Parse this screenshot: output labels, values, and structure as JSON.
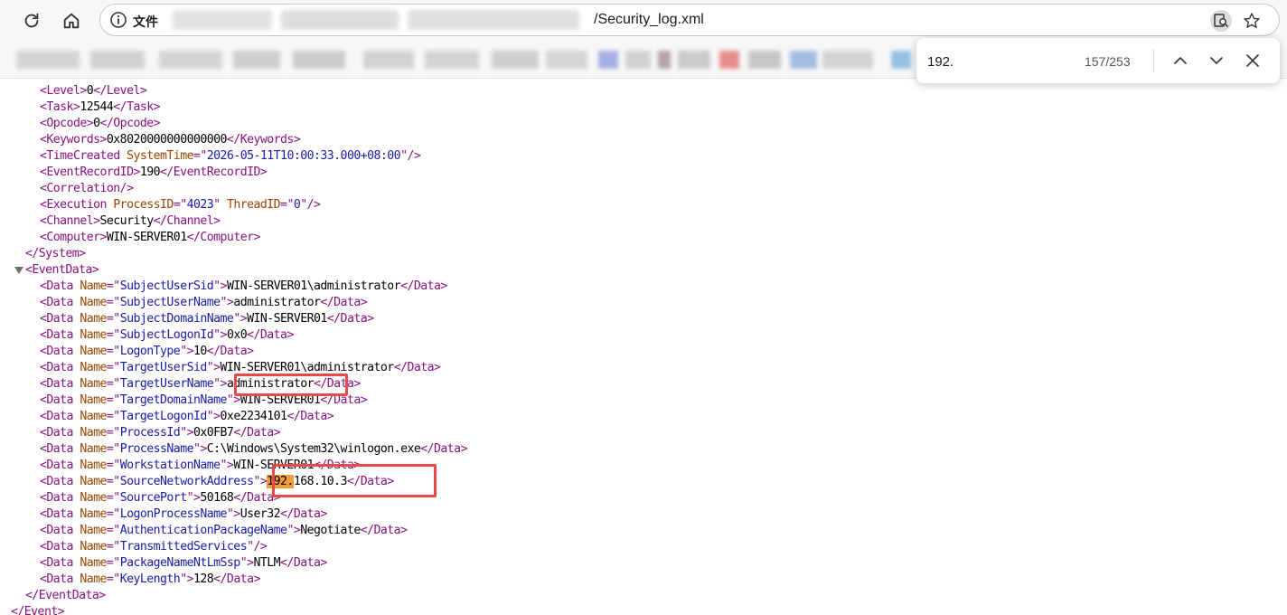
{
  "address_bar": {
    "scheme_label": "文件",
    "url_visible": "/Security_log.xml"
  },
  "find_bar": {
    "query": "192.",
    "match_count": "157/253"
  },
  "xml_lines": [
    [
      [
        "tag",
        "<Level>"
      ],
      [
        "text",
        "0"
      ],
      [
        "tag",
        "</Level>"
      ]
    ],
    [
      [
        "tag",
        "<Task>"
      ],
      [
        "text",
        "12544"
      ],
      [
        "tag",
        "</Task>"
      ]
    ],
    [
      [
        "tag",
        "<Opcode>"
      ],
      [
        "text",
        "0"
      ],
      [
        "tag",
        "</Opcode>"
      ]
    ],
    [
      [
        "tag",
        "<Keywords>"
      ],
      [
        "text",
        "0x8020000000000000"
      ],
      [
        "tag",
        "</Keywords>"
      ]
    ],
    [
      [
        "tag",
        "<TimeCreated "
      ],
      [
        "attr",
        "SystemTime"
      ],
      [
        "tag",
        "=\""
      ],
      [
        "val",
        "2026-05-11T10:00:33.000+08:00"
      ],
      [
        "tag",
        "\"/>"
      ]
    ],
    [
      [
        "tag",
        "<EventRecordID>"
      ],
      [
        "text",
        "190"
      ],
      [
        "tag",
        "</EventRecordID>"
      ]
    ],
    [
      [
        "tag",
        "<Correlation/>"
      ]
    ],
    [
      [
        "tag",
        "<Execution "
      ],
      [
        "attr",
        "ProcessID"
      ],
      [
        "tag",
        "=\""
      ],
      [
        "val",
        "4023"
      ],
      [
        "tag",
        "\" "
      ],
      [
        "attr",
        "ThreadID"
      ],
      [
        "tag",
        "=\""
      ],
      [
        "val",
        "0"
      ],
      [
        "tag",
        "\"/>"
      ]
    ],
    [
      [
        "tag",
        "<Channel>"
      ],
      [
        "text",
        "Security"
      ],
      [
        "tag",
        "</Channel>"
      ]
    ],
    [
      [
        "tag",
        "<Computer>"
      ],
      [
        "text",
        "WIN-SERVER01"
      ],
      [
        "tag",
        "</Computer>"
      ]
    ],
    [
      [
        "tag",
        "</System>"
      ]
    ],
    [
      [
        "tag",
        "<EventData>"
      ]
    ],
    [
      [
        "tag",
        "<Data "
      ],
      [
        "attr",
        "Name"
      ],
      [
        "tag",
        "=\""
      ],
      [
        "val",
        "SubjectUserSid"
      ],
      [
        "tag",
        "\">"
      ],
      [
        "text",
        "WIN-SERVER01\\administrator"
      ],
      [
        "tag",
        "</Data>"
      ]
    ],
    [
      [
        "tag",
        "<Data "
      ],
      [
        "attr",
        "Name"
      ],
      [
        "tag",
        "=\""
      ],
      [
        "val",
        "SubjectUserName"
      ],
      [
        "tag",
        "\">"
      ],
      [
        "text",
        "administrator"
      ],
      [
        "tag",
        "</Data>"
      ]
    ],
    [
      [
        "tag",
        "<Data "
      ],
      [
        "attr",
        "Name"
      ],
      [
        "tag",
        "=\""
      ],
      [
        "val",
        "SubjectDomainName"
      ],
      [
        "tag",
        "\">"
      ],
      [
        "text",
        "WIN-SERVER01"
      ],
      [
        "tag",
        "</Data>"
      ]
    ],
    [
      [
        "tag",
        "<Data "
      ],
      [
        "attr",
        "Name"
      ],
      [
        "tag",
        "=\""
      ],
      [
        "val",
        "SubjectLogonId"
      ],
      [
        "tag",
        "\">"
      ],
      [
        "text",
        "0x0"
      ],
      [
        "tag",
        "</Data>"
      ]
    ],
    [
      [
        "tag",
        "<Data "
      ],
      [
        "attr",
        "Name"
      ],
      [
        "tag",
        "=\""
      ],
      [
        "val",
        "LogonType"
      ],
      [
        "tag",
        "\">"
      ],
      [
        "text",
        "10"
      ],
      [
        "tag",
        "</Data>"
      ]
    ],
    [
      [
        "tag",
        "<Data "
      ],
      [
        "attr",
        "Name"
      ],
      [
        "tag",
        "=\""
      ],
      [
        "val",
        "TargetUserSid"
      ],
      [
        "tag",
        "\">"
      ],
      [
        "text",
        "WIN-SERVER01\\administrator"
      ],
      [
        "tag",
        "</Data>"
      ]
    ],
    [
      [
        "tag",
        "<Data "
      ],
      [
        "attr",
        "Name"
      ],
      [
        "tag",
        "=\""
      ],
      [
        "val",
        "TargetUserName"
      ],
      [
        "tag",
        "\">"
      ],
      [
        "text",
        "administrator"
      ],
      [
        "tag",
        "</Data>"
      ]
    ],
    [
      [
        "tag",
        "<Data "
      ],
      [
        "attr",
        "Name"
      ],
      [
        "tag",
        "=\""
      ],
      [
        "val",
        "TargetDomainName"
      ],
      [
        "tag",
        "\">"
      ],
      [
        "text",
        "WIN-SERVER01"
      ],
      [
        "tag",
        "</Data>"
      ]
    ],
    [
      [
        "tag",
        "<Data "
      ],
      [
        "attr",
        "Name"
      ],
      [
        "tag",
        "=\""
      ],
      [
        "val",
        "TargetLogonId"
      ],
      [
        "tag",
        "\">"
      ],
      [
        "text",
        "0xe2234101"
      ],
      [
        "tag",
        "</Data>"
      ]
    ],
    [
      [
        "tag",
        "<Data "
      ],
      [
        "attr",
        "Name"
      ],
      [
        "tag",
        "=\""
      ],
      [
        "val",
        "ProcessId"
      ],
      [
        "tag",
        "\">"
      ],
      [
        "text",
        "0x0FB7"
      ],
      [
        "tag",
        "</Data>"
      ]
    ],
    [
      [
        "tag",
        "<Data "
      ],
      [
        "attr",
        "Name"
      ],
      [
        "tag",
        "=\""
      ],
      [
        "val",
        "ProcessName"
      ],
      [
        "tag",
        "\">"
      ],
      [
        "text",
        "C:\\Windows\\System32\\winlogon.exe"
      ],
      [
        "tag",
        "</Data>"
      ]
    ],
    [
      [
        "tag",
        "<Data "
      ],
      [
        "attr",
        "Name"
      ],
      [
        "tag",
        "=\""
      ],
      [
        "val",
        "WorkstationName"
      ],
      [
        "tag",
        "\">"
      ],
      [
        "text",
        "WIN-SERVER01"
      ],
      [
        "tag",
        "</Data>"
      ]
    ],
    [
      [
        "tag",
        "<Data "
      ],
      [
        "attr",
        "Name"
      ],
      [
        "tag",
        "=\""
      ],
      [
        "val",
        "SourceNetworkAddress"
      ],
      [
        "tag",
        "\">"
      ],
      [
        "mark",
        "192."
      ],
      [
        "text",
        "168.10.3"
      ],
      [
        "tag",
        "</Data>"
      ]
    ],
    [
      [
        "tag",
        "<Data "
      ],
      [
        "attr",
        "Name"
      ],
      [
        "tag",
        "=\""
      ],
      [
        "val",
        "SourcePort"
      ],
      [
        "tag",
        "\">"
      ],
      [
        "text",
        "50168"
      ],
      [
        "tag",
        "</Data>"
      ]
    ],
    [
      [
        "tag",
        "<Data "
      ],
      [
        "attr",
        "Name"
      ],
      [
        "tag",
        "=\""
      ],
      [
        "val",
        "LogonProcessName"
      ],
      [
        "tag",
        "\">"
      ],
      [
        "text",
        "User32"
      ],
      [
        "tag",
        "</Data>"
      ]
    ],
    [
      [
        "tag",
        "<Data "
      ],
      [
        "attr",
        "Name"
      ],
      [
        "tag",
        "=\""
      ],
      [
        "val",
        "AuthenticationPackageName"
      ],
      [
        "tag",
        "\">"
      ],
      [
        "text",
        "Negotiate"
      ],
      [
        "tag",
        "</Data>"
      ]
    ],
    [
      [
        "tag",
        "<Data "
      ],
      [
        "attr",
        "Name"
      ],
      [
        "tag",
        "=\""
      ],
      [
        "val",
        "TransmittedServices"
      ],
      [
        "tag",
        "\"/>"
      ]
    ],
    [
      [
        "tag",
        "<Data "
      ],
      [
        "attr",
        "Name"
      ],
      [
        "tag",
        "=\""
      ],
      [
        "val",
        "PackageNameNtLmSsp"
      ],
      [
        "tag",
        "\">"
      ],
      [
        "text",
        "NTLM"
      ],
      [
        "tag",
        "</Data>"
      ]
    ],
    [
      [
        "tag",
        "<Data "
      ],
      [
        "attr",
        "Name"
      ],
      [
        "tag",
        "=\""
      ],
      [
        "val",
        "KeyLength"
      ],
      [
        "tag",
        "\">"
      ],
      [
        "text",
        "128"
      ],
      [
        "tag",
        "</Data>"
      ]
    ],
    [
      [
        "tag",
        "</EventData>"
      ]
    ],
    [
      [
        "tag",
        "</Event>"
      ]
    ]
  ],
  "colors": {
    "tag": "#881280",
    "attr": "#994500",
    "value": "#1a1aa6",
    "highlight": "#f29b38",
    "annotation_box": "#e64a4a"
  }
}
